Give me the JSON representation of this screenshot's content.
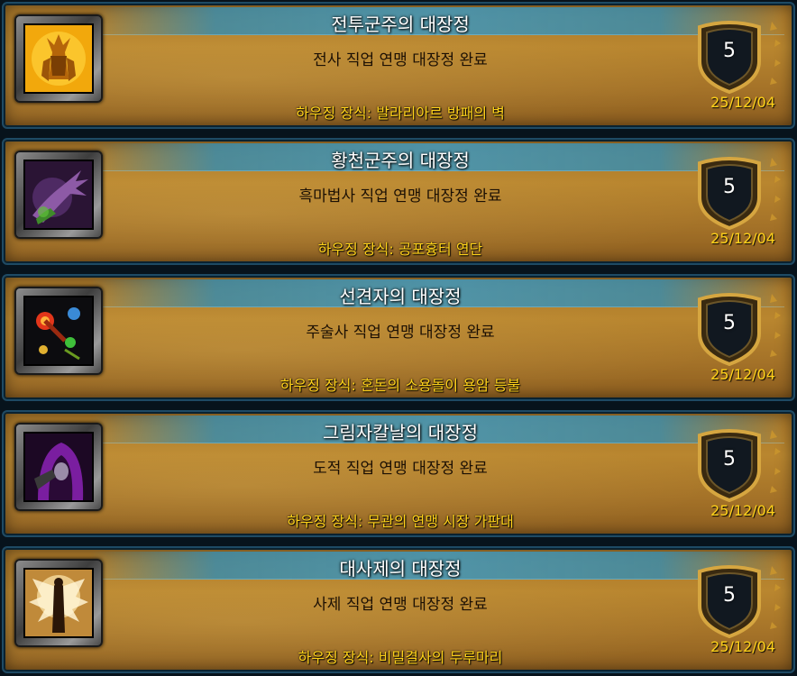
{
  "achievements": [
    {
      "title": "전투군주의 대장정",
      "description": "전사 직업 연맹 대장정 완료",
      "reward": "하우징 장식: 발라리아르 방패의 벽",
      "points": "5",
      "date": "25/12/04",
      "icon": "warrior-armor-icon"
    },
    {
      "title": "황천군주의 대장정",
      "description": "흑마법사 직업 연맹 대장정 완료",
      "reward": "하우징 장식: 공포흉터 연단",
      "points": "5",
      "date": "25/12/04",
      "icon": "fel-claw-icon"
    },
    {
      "title": "선견자의 대장정",
      "description": "주술사 직업 연맹 대장정 완료",
      "reward": "하우징 장식: 혼돈의 소용돌이 용암 등불",
      "points": "5",
      "date": "25/12/04",
      "icon": "elemental-orbs-icon"
    },
    {
      "title": "그림자칼날의 대장정",
      "description": "도적 직업 연맹 대장정 완료",
      "reward": "하우징 장식: 무관의 연맹 시장 가판대",
      "points": "5",
      "date": "25/12/04",
      "icon": "hooded-rogue-icon"
    },
    {
      "title": "대사제의 대장정",
      "description": "사제 직업 연맹 대장정 완료",
      "reward": "하우징 장식: 비밀결사의 두루마리",
      "points": "5",
      "date": "25/12/04",
      "icon": "winged-priest-icon"
    }
  ]
}
